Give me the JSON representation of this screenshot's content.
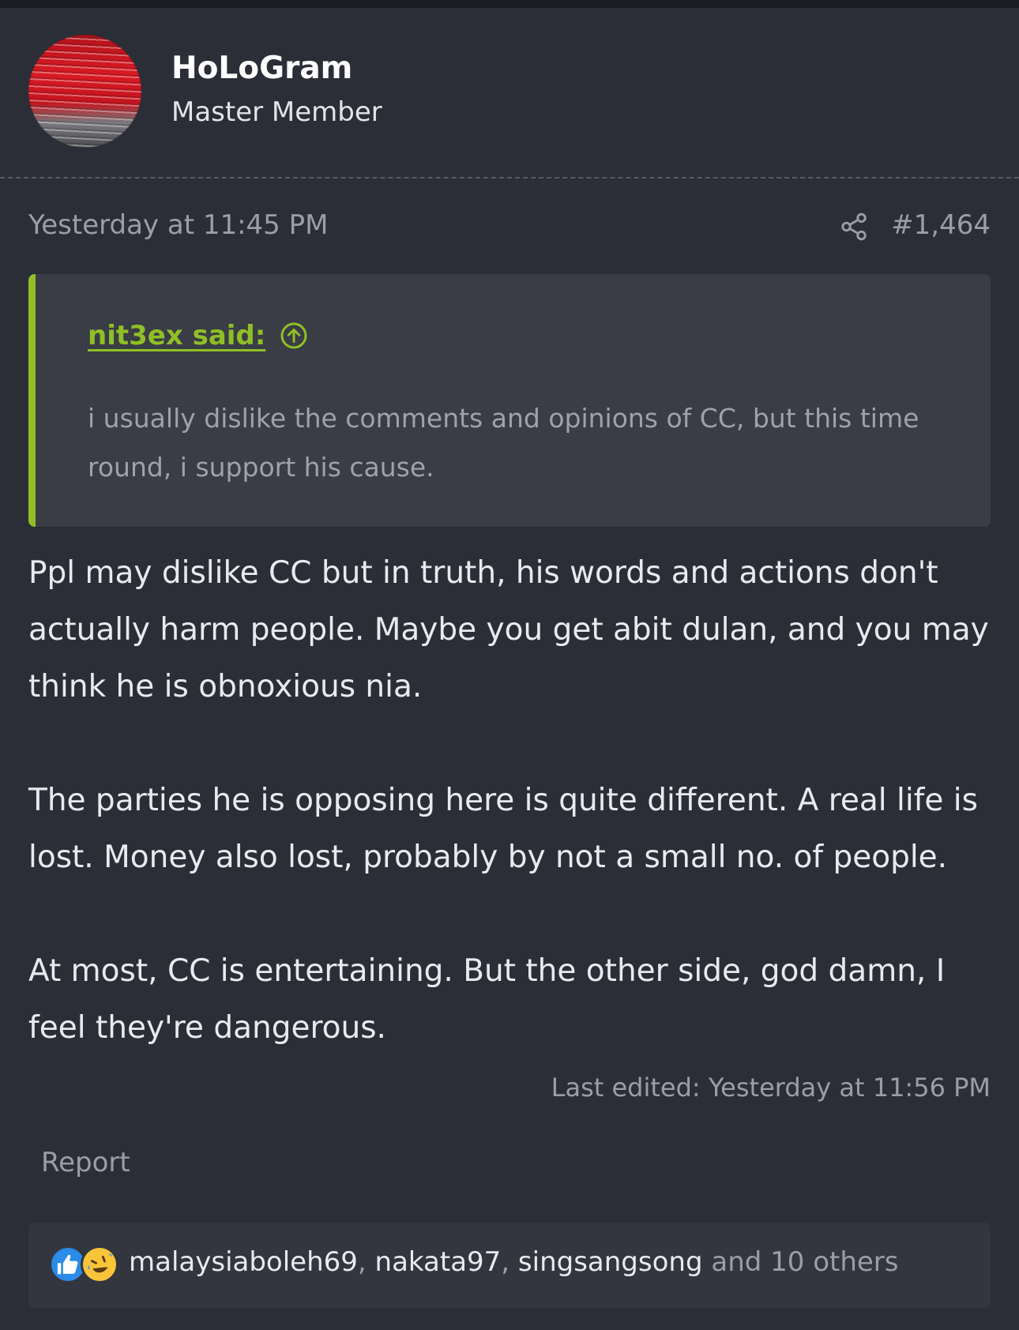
{
  "post": {
    "author": {
      "username": "HoLoGram",
      "title": "Master Member"
    },
    "date": "Yesterday at 11:45 PM",
    "number": "#1,464",
    "quote": {
      "author": "nit3ex said:",
      "text": "i usually dislike the comments and opinions of CC, but this time round, i support his cause."
    },
    "body": {
      "paragraph_1": "Ppl may dislike CC but in truth, his words and actions don't actually harm people. Maybe you get abit dulan, and you may think he is obnoxious nia.",
      "paragraph_2": "The parties he is opposing here is quite different. A real life is lost. Money also lost, probably by not a small no. of people.",
      "paragraph_3": "At most, CC is entertaining. But the other side, god damn, I feel they're dangerous."
    },
    "last_edited": "Last edited: Yesterday at 11:56 PM",
    "report_label": "Report"
  },
  "reactions": {
    "icons": [
      "like-icon",
      "haha-icon"
    ],
    "users": [
      "malaysiaboleh69",
      "nakata97",
      "singsangsong"
    ],
    "separator": ", ",
    "others": " and 10 others"
  },
  "colors": {
    "background": "#2c2e37",
    "quote_background": "#3a3c46",
    "accent_green": "#8fbf25",
    "muted_text": "#9a9ea8",
    "like_blue": "#2b8be8"
  }
}
